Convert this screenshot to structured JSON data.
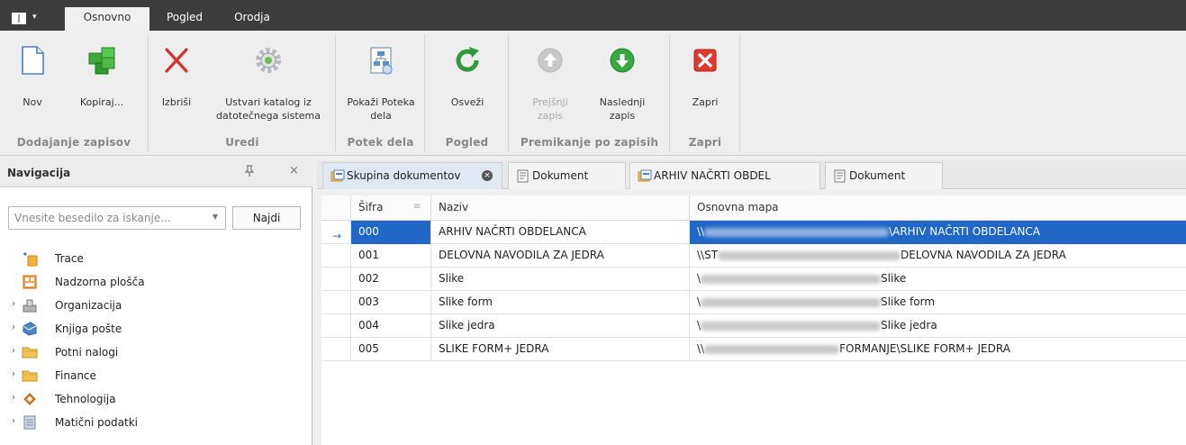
{
  "tabs": {
    "app_menu_caret": "▾",
    "items": [
      "Osnovno",
      "Pogled",
      "Orodja"
    ]
  },
  "ribbon": {
    "groups": [
      {
        "label": "Dodajanje zapisov",
        "buttons": [
          {
            "label": "Nov"
          },
          {
            "label": "Kopiraj..."
          }
        ]
      },
      {
        "label": "Uredi",
        "buttons": [
          {
            "label": "Izbriši"
          },
          {
            "label": "Ustvari katalog iz datotečnega sistema"
          }
        ]
      },
      {
        "label": "Potek dela",
        "buttons": [
          {
            "label": "Pokaži Poteka dela"
          }
        ]
      },
      {
        "label": "Pogled",
        "buttons": [
          {
            "label": "Osveži"
          }
        ]
      },
      {
        "label": "Premikanje po zapisih",
        "buttons": [
          {
            "label": "Prejšnji zapis",
            "disabled": true
          },
          {
            "label": "Naslednji zapis"
          }
        ]
      },
      {
        "label": "Zapri",
        "buttons": [
          {
            "label": "Zapri"
          }
        ]
      }
    ]
  },
  "navigation": {
    "title": "Navigacija",
    "pin": "📌",
    "close": "×",
    "search_placeholder": "Vnesite besedilo za iskanje...",
    "find_label": "Najdi",
    "items": [
      {
        "label": "Trace",
        "icon": "trace-icon",
        "expandable": false
      },
      {
        "label": "Nadzorna plošča",
        "icon": "dashboard-icon",
        "expandable": false
      },
      {
        "label": "Organizacija",
        "icon": "organization-icon",
        "expandable": true
      },
      {
        "label": "Knjiga pošte",
        "icon": "mail-book-icon",
        "expandable": true
      },
      {
        "label": "Potni nalogi",
        "icon": "folder-icon",
        "expandable": true
      },
      {
        "label": "Finance",
        "icon": "folder-icon",
        "expandable": true
      },
      {
        "label": "Tehnologija",
        "icon": "technology-icon",
        "expandable": true
      },
      {
        "label": "Matični podatki",
        "icon": "master-data-icon",
        "expandable": true
      }
    ]
  },
  "doc_tabs": [
    {
      "label": "Skupina dokumentov",
      "icon": "group-icon",
      "active": true,
      "closable": true
    },
    {
      "label": "Dokument",
      "icon": "document-icon",
      "active": false
    },
    {
      "label": "ARHIV NAČRTI OBDEL",
      "icon": "group-icon",
      "active": false
    },
    {
      "label": "Dokument",
      "icon": "document-icon",
      "active": false
    }
  ],
  "grid": {
    "columns": [
      "Šifra",
      "Naziv",
      "Osnovna mapa"
    ],
    "rows": [
      {
        "code": "000",
        "name": "ARHIV NAČRTI OBDELANCA",
        "path_prefix": "\\\\",
        "path_suffix": "\\ARHIV NAČRTI OBDELANCA",
        "selected": true
      },
      {
        "code": "001",
        "name": "DELOVNA NAVODILA ZA JEDRA",
        "path_prefix": "\\\\ST",
        "path_suffix": "DELOVNA NAVODILA ZA JEDRA",
        "selected": false
      },
      {
        "code": "002",
        "name": "Slike",
        "path_prefix": "\\",
        "path_suffix": "Slike",
        "selected": false
      },
      {
        "code": "003",
        "name": "Slike form",
        "path_prefix": "\\",
        "path_suffix": "Slike form",
        "selected": false
      },
      {
        "code": "004",
        "name": "Slike jedra",
        "path_prefix": "\\",
        "path_suffix": "Slike jedra",
        "selected": false
      },
      {
        "code": "005",
        "name": "SLIKE FORM+ JEDRA",
        "path_prefix": "\\\\",
        "path_suffix": "FORMANJE\\SLIKE FORM+ JEDRA",
        "selected": false
      }
    ],
    "row_pointer": "→"
  }
}
